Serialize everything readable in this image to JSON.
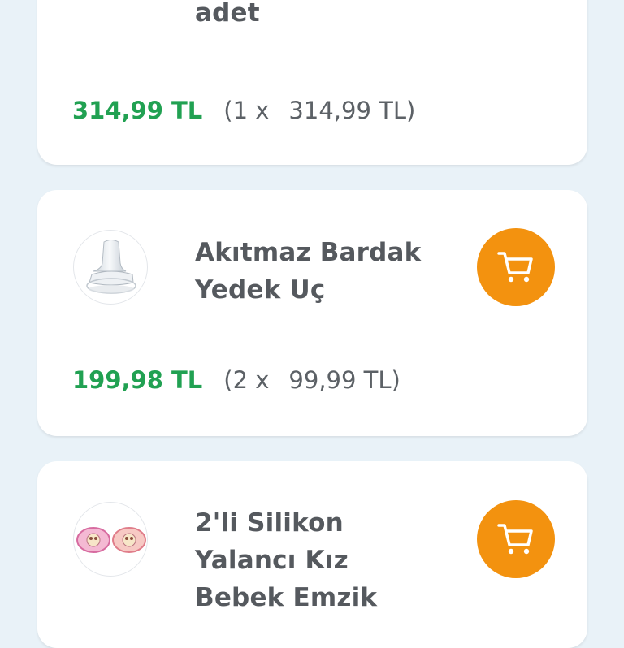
{
  "colors": {
    "background": "#e9f2f8",
    "card": "#ffffff",
    "price_green": "#21a152",
    "cart_orange": "#f3920f",
    "title_gray": "#55595e"
  },
  "items": [
    {
      "title": "adet",
      "total": "314,99 TL",
      "qty": "(1 x",
      "unit_price": "314,99 TL)",
      "cart_icon": "shopping-cart-icon"
    },
    {
      "title": "Akıtmaz Bardak\nYedek Uç",
      "total": "199,98 TL",
      "qty": "(2 x",
      "unit_price": "99,99 TL)",
      "cart_icon": "shopping-cart-icon"
    },
    {
      "title": " 2'li Silikon\nYalancı Kız\nBebek Emzik",
      "cart_icon": "shopping-cart-icon"
    }
  ]
}
